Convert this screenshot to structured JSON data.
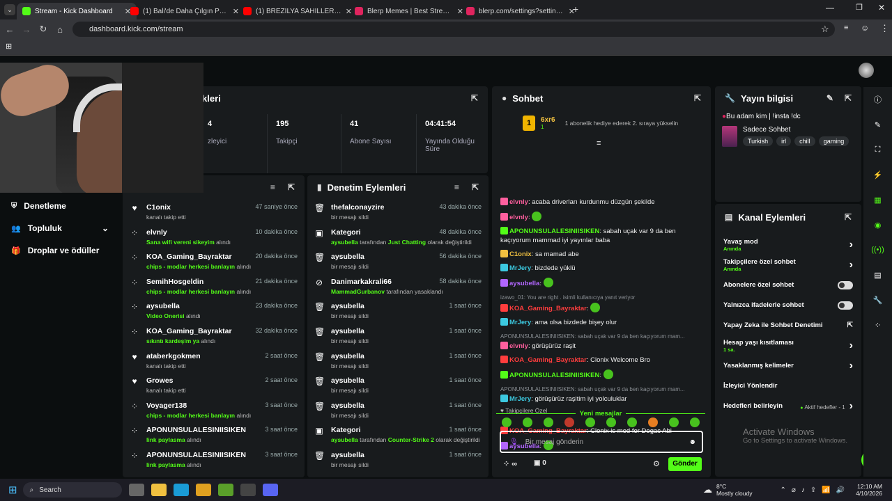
{
  "browser": {
    "tabs": [
      {
        "title": "Stream - Kick Dashboard",
        "color": "#53fc18",
        "active": true
      },
      {
        "title": "(1) Bali'de Daha Çılgın Parti Gör",
        "color": "#ff0000",
        "active": false
      },
      {
        "title": "(1) BREZİLYA SAHİLLERİNDE Sİ",
        "color": "#ff0000",
        "active": false
      },
      {
        "title": "Blerp Memes | Best Streamer Sou",
        "color": "#e0245e",
        "active": false
      },
      {
        "title": "blerp.com/settings?settingsTyp",
        "color": "#e0245e",
        "active": false
      }
    ],
    "url": "dashboard.kick.com/stream"
  },
  "stats_panel": {
    "title": "kleri",
    "stats": [
      {
        "value": "4",
        "label": "zleyici"
      },
      {
        "value": "195",
        "label": "Takipçi"
      },
      {
        "value": "41",
        "label": "Abone Sayısı"
      },
      {
        "value": "04:41:54",
        "label": "Yayında Olduğu Süre"
      }
    ]
  },
  "left_nav": [
    {
      "label": "Denetleme",
      "icon": "shield-icon"
    },
    {
      "label": "Topluluk",
      "icon": "users-icon"
    },
    {
      "label": "Droplar ve ödüller",
      "icon": "gift-icon"
    }
  ],
  "activity": [
    {
      "name": "C1onix",
      "time": "47 saniye önce",
      "sub": "kanalı takip etti",
      "icon": "heart"
    },
    {
      "name": "elvnly",
      "time": "10 dakika önce",
      "sub_green": "Sana wifi vereni sikeyim",
      "sub": " alındı",
      "icon": "points"
    },
    {
      "name": "KOA_Gaming_Bayraktar",
      "time": "20 dakika önce",
      "sub_green": "chips - modlar herkesi banlayın",
      "sub": " alındı",
      "icon": "points"
    },
    {
      "name": "SemihHosgeldin",
      "time": "21 dakika önce",
      "sub_green": "chips - modlar herkesi banlayın",
      "sub": " alındı",
      "icon": "points"
    },
    {
      "name": "aysubella",
      "time": "23 dakika önce",
      "sub_green": "Video Onerisi",
      "sub": " alındı",
      "icon": "points"
    },
    {
      "name": "KOA_Gaming_Bayraktar",
      "time": "32 dakika önce",
      "sub_green": "sıkıntı kardeşim ya",
      "sub": " alındı",
      "icon": "points"
    },
    {
      "name": "ataberkgokmen",
      "time": "2 saat önce",
      "sub": "kanalı takip etti",
      "icon": "heart"
    },
    {
      "name": "Growes",
      "time": "2 saat önce",
      "sub": "kanalı takip etti",
      "icon": "heart"
    },
    {
      "name": "Voyager138",
      "time": "3 saat önce",
      "sub_green": "chips - modlar herkesi banlayın",
      "sub": " alındı",
      "icon": "points"
    },
    {
      "name": "APONUNSULALESINIISIKEN",
      "time": "3 saat önce",
      "sub_green": "link paylasma",
      "sub": " alındı",
      "icon": "points"
    },
    {
      "name": "APONUNSULALESINIISIKEN",
      "time": "3 saat önce",
      "sub_green": "link paylasma",
      "sub": " alındı",
      "icon": "points"
    }
  ],
  "moderation": {
    "title": "Denetim Eylemleri",
    "rows": [
      {
        "name": "thefalconayzire",
        "time": "43 dakika önce",
        "sub": "bir mesajı sildi",
        "icon": "trash"
      },
      {
        "name": "Kategori",
        "time": "48 dakika önce",
        "sub_pre": "aysubella",
        "sub": " tarafından ",
        "sub_green": "Just Chatting",
        "sub_post": " olarak değiştirildi",
        "icon": "category"
      },
      {
        "name": "aysubella",
        "time": "56 dakika önce",
        "sub": "bir mesajı sildi",
        "icon": "trash"
      },
      {
        "name": "Danimarkakrali66",
        "time": "58 dakika önce",
        "sub_pre": "MammadGurbanov",
        "sub": " tarafından yasaklandı",
        "icon": "ban"
      },
      {
        "name": "aysubella",
        "time": "1 saat önce",
        "sub": "bir mesajı sildi",
        "icon": "trash"
      },
      {
        "name": "aysubella",
        "time": "1 saat önce",
        "sub": "bir mesajı sildi",
        "icon": "trash"
      },
      {
        "name": "aysubella",
        "time": "1 saat önce",
        "sub": "bir mesajı sildi",
        "icon": "trash"
      },
      {
        "name": "aysubella",
        "time": "1 saat önce",
        "sub": "bir mesajı sildi",
        "icon": "trash"
      },
      {
        "name": "aysubella",
        "time": "1 saat önce",
        "sub": "bir mesajı sildi",
        "icon": "trash"
      },
      {
        "name": "Kategori",
        "time": "1 saat önce",
        "sub_pre": "aysubella",
        "sub": " tarafından ",
        "sub_green": "Counter-Strike 2",
        "sub_post": " olarak değiştirildi",
        "icon": "category"
      },
      {
        "name": "aysubella",
        "time": "1 saat önce",
        "sub": "bir mesajı sildi",
        "icon": "trash"
      }
    ]
  },
  "chat": {
    "title": "Sohbet",
    "gifter": "6xr6",
    "gift_count": "1",
    "gift_text": "1 abonelik hediye ederek 2. sıraya yükselin",
    "messages": [
      {
        "user": "elvnly",
        "color": "#ff5f9e",
        "text": ": acaba driverları kurdunmu düzgün şekilde"
      },
      {
        "user": "elvnly",
        "color": "#ff5f9e",
        "text": ": ",
        "emote": true
      },
      {
        "user": "APONUNSULALESINIISIKEN",
        "color": "#53fc18",
        "text": ": sabah uçak var 9 da ben kaçıyorum mammad iyi yayınlar baba"
      },
      {
        "user": "C1onix",
        "color": "#f0c040",
        "text": ": sa mamad abe"
      },
      {
        "user": "MrJery",
        "color": "#3cc9e0",
        "text": ": bizdede yüklü"
      },
      {
        "user": "aysubella",
        "color": "#b266ff",
        "text": ": ",
        "emote": true
      },
      {
        "reply": "izawo_01: You are right . isimli kullanıcıya yanıt veriyor",
        "user": "KOA_Gaming_Bayraktar",
        "color": "#ff3d3d",
        "text": ": ",
        "emote": true
      },
      {
        "user": "MrJery",
        "color": "#3cc9e0",
        "text": ": ama olsa bizdede bişey olur"
      },
      {
        "reply": "APONUNSULALESINIISIKEN: sabah uçak var 9 da ben kaçıyorum mam...",
        "user": "elvnly",
        "color": "#ff5f9e",
        "text": ": görüşürüz raşit"
      },
      {
        "user": "KOA_Gaming_Bayraktar",
        "color": "#ff3d3d",
        "text": ": Clonix Welcome Bro"
      },
      {
        "user": "APONUNSULALESINIISIKEN",
        "color": "#53fc18",
        "text": ": ",
        "emote": true
      },
      {
        "reply": "APONUNSULALESINIISIKEN: sabah uçak var 9 da ben kaçıyorum mam...",
        "user": "MrJery",
        "color": "#3cc9e0",
        "text": ": görüşürüz raşitim iyi yolculuklar"
      }
    ],
    "new_label": "Yeni mesajlar",
    "new_messages": [
      {
        "user": "KOA_Gaming_Bayraktar",
        "color": "#ff3d3d",
        "text": ": Clonix is mod for Dogac Abi"
      },
      {
        "user": "aysubella",
        "color": "#b266ff",
        "text": ": ",
        "emote": true
      }
    ],
    "followers_label": "Takipçilere Özel",
    "input_placeholder": "Bir mesaj gönderin",
    "points_value": "∞",
    "gift_value": "0",
    "send_label": "Gönder"
  },
  "stream_info": {
    "title": "Yayın bilgisi",
    "stream_title": "Bu adam kim | !insta !dc",
    "category": "Sadece Sohbet",
    "tags": [
      "Turkish",
      "irl",
      "chill",
      "gaming"
    ]
  },
  "channel_actions": {
    "title": "Kanal Eylemleri",
    "rows": [
      {
        "label": "Yavaş mod",
        "sub": "Anında",
        "ctrl": "chevron"
      },
      {
        "label": "Takipçilere özel sohbet",
        "sub": "Anında",
        "ctrl": "chevron"
      },
      {
        "label": "Abonelere özel sohbet",
        "ctrl": "toggle"
      },
      {
        "label": "Yalnızca ifadelerle sohbet",
        "ctrl": "toggle"
      },
      {
        "label": "Yapay Zeka ile Sohbet Denetimi",
        "ctrl": "external"
      },
      {
        "label": "Hesap yaşı kısıtlaması",
        "sub": "1 sa.",
        "ctrl": "chevron"
      },
      {
        "label": "Yasaklanmış kelimeler",
        "ctrl": "chevron"
      },
      {
        "label": "İzleyici Yönlendir",
        "ctrl": "none"
      },
      {
        "label": "Hedefleri belirleyin",
        "extra": "Aktif hedefler - 1",
        "ctrl": "chevron"
      }
    ]
  },
  "watermark": {
    "title": "Activate Windows",
    "sub": "Go to Settings to activate Windows."
  },
  "taskbar": {
    "search": "Search",
    "weather_temp": "8°C",
    "weather_text": "Mostly cloudy",
    "time": "12:10 AM",
    "date": "4/10/2026"
  }
}
